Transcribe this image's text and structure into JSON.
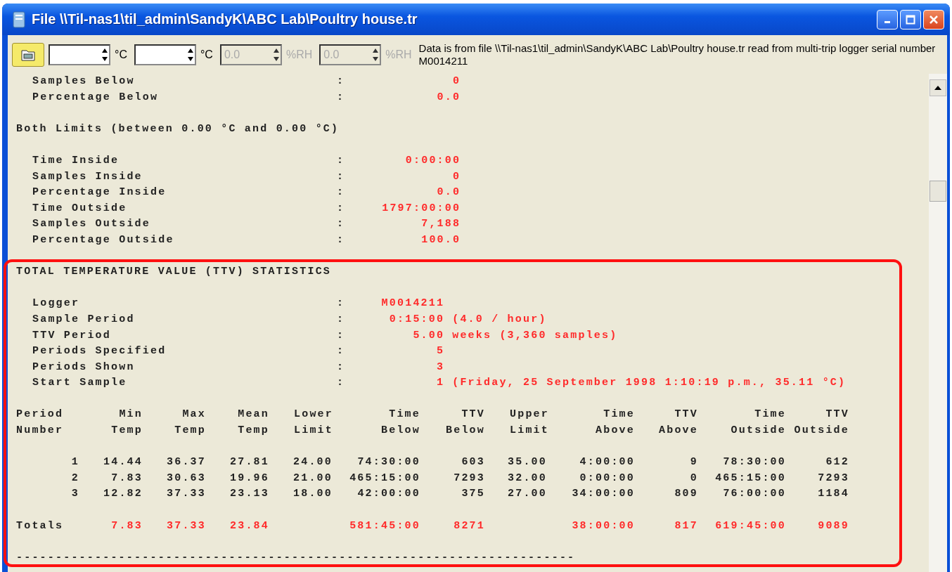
{
  "window": {
    "title": "File \\\\Til-nas1\\til_admin\\SandyK\\ABC Lab\\Poultry house.tr"
  },
  "toolbar": {
    "fields": [
      {
        "unit": "°C",
        "disabled": false
      },
      {
        "unit": "°C",
        "disabled": false
      },
      {
        "value": "0.0",
        "unit": "%RH",
        "disabled": true
      },
      {
        "value": "0.0",
        "unit": "%RH",
        "disabled": true
      }
    ],
    "info": "Data is from file \\\\Til-nas1\\til_admin\\SandyK\\ABC Lab\\Poultry house.tr read from multi-trip logger serial number M0014211"
  },
  "sections": [
    {
      "rows": [
        {
          "label": "Samples Below",
          "sep": ":",
          "value": "0"
        },
        {
          "label": "Percentage Below",
          "sep": ":",
          "value": "0.0"
        }
      ]
    },
    {
      "heading": "Both Limits (between 0.00 °C and 0.00 °C)",
      "rows": [
        {
          "label": "Time Inside",
          "sep": ":",
          "value": "0:00:00"
        },
        {
          "label": "Samples Inside",
          "sep": ":",
          "value": "0"
        },
        {
          "label": "Percentage Inside",
          "sep": ":",
          "value": "0.0"
        },
        {
          "label": "Time Outside",
          "sep": ":",
          "value": "1797:00:00"
        },
        {
          "label": "Samples Outside",
          "sep": ":",
          "value": "7,188"
        },
        {
          "label": "Percentage Outside",
          "sep": ":",
          "value": "100.0"
        }
      ]
    },
    {
      "heading": "TOTAL TEMPERATURE VALUE (TTV) STATISTICS",
      "rows": [
        {
          "label": "Logger",
          "sep": ":",
          "value": "M0014211"
        },
        {
          "label": "Sample Period",
          "sep": ":",
          "value": "0:15:00",
          "suffix": "(4.0 / hour)"
        },
        {
          "label": "TTV Period",
          "sep": ":",
          "value": "5.00",
          "suffix": "weeks (3,360 samples)"
        },
        {
          "label": "Periods Specified",
          "sep": ":",
          "value": "5"
        },
        {
          "label": "Periods Shown",
          "sep": ":",
          "value": "3"
        },
        {
          "label": "Start Sample",
          "sep": ":",
          "value": "1",
          "suffix": "(Friday, 25 September 1998 1:10:19 p.m., 35.11 °C)"
        }
      ],
      "table": {
        "header_rows": [
          [
            "Period",
            "Min",
            "Max",
            "Mean",
            "Lower",
            "Time",
            "TTV",
            "Upper",
            "Time",
            "TTV",
            "Time",
            "TTV"
          ],
          [
            "Number",
            "Temp",
            "Temp",
            "Temp",
            "Limit",
            "Below",
            "Below",
            "Limit",
            "Above",
            "Above",
            "Outside",
            "Outside"
          ]
        ],
        "rows": [
          [
            "1",
            "14.44",
            "36.37",
            "27.81",
            "24.00",
            "74:30:00",
            "603",
            "35.00",
            "4:00:00",
            "9",
            "78:30:00",
            "612"
          ],
          [
            "2",
            "7.83",
            "30.63",
            "19.96",
            "21.00",
            "465:15:00",
            "7293",
            "32.00",
            "0:00:00",
            "0",
            "465:15:00",
            "7293"
          ],
          [
            "3",
            "12.82",
            "37.33",
            "23.13",
            "18.00",
            "42:00:00",
            "375",
            "27.00",
            "34:00:00",
            "809",
            "76:00:00",
            "1184"
          ]
        ],
        "totals": {
          "label": "Totals",
          "min_temp": "7.83",
          "max_temp": "37.33",
          "mean_temp": "23.84",
          "time_below": "581:45:00",
          "ttv_below": "8271",
          "time_above": "38:00:00",
          "ttv_above": "817",
          "time_outside": "619:45:00",
          "ttv_outside": "9089"
        }
      },
      "rule": "-----------------------------------------------------------------------"
    }
  ]
}
